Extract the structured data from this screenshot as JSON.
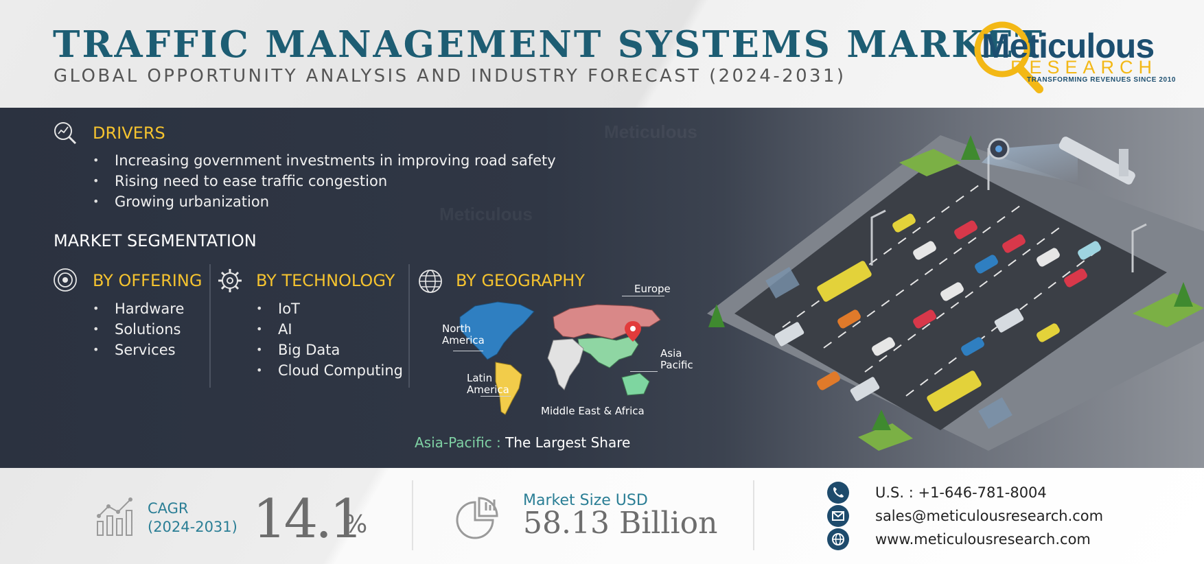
{
  "header": {
    "title": "TRAFFIC MANAGEMENT SYSTEMS MARKET",
    "subtitle": "GLOBAL OPPORTUNITY ANALYSIS AND INDUSTRY FORECAST (2024-2031)"
  },
  "logo": {
    "word_main": "Meticulous",
    "word_sub": "RESEARCH",
    "tagline": "TRANSFORMING REVENUES SINCE 2010"
  },
  "drivers": {
    "heading": "DRIVERS",
    "icon": "magnifier-chart-icon",
    "items": [
      "Increasing government investments in improving road safety",
      "Rising need to ease traffic congestion",
      "Growing urbanization"
    ]
  },
  "segmentation": {
    "title": "MARKET SEGMENTATION",
    "offering": {
      "heading": "BY OFFERING",
      "icon": "target-icon",
      "items": [
        "Hardware",
        "Solutions",
        "Services"
      ]
    },
    "technology": {
      "heading": "BY TECHNOLOGY",
      "icon": "gear-circuit-icon",
      "items": [
        "IoT",
        "AI",
        "Big Data",
        "Cloud Computing"
      ]
    },
    "geography": {
      "heading": "BY GEOGRAPHY",
      "icon": "globe-icon",
      "regions": {
        "europe": "Europe",
        "north_america": "North\nAmerica",
        "asia_pacific": "Asia\nPacific",
        "latin_america": "Latin\nAmerica",
        "mea": "Middle East & Africa"
      },
      "colors": {
        "north_america": "#2f7fc1",
        "europe_asia": "#d98888",
        "asia_pacific": "#8fd6a3",
        "latin_america": "#f2cc4a",
        "africa": "#e2e2e2",
        "oceania": "#7ed6a0"
      }
    },
    "largest_share": {
      "region": "Asia-Pacific :",
      "text": " The Largest Share"
    }
  },
  "footer": {
    "cagr": {
      "label": "CAGR",
      "period": "(2024-2031)",
      "value": "14.1",
      "unit": "%",
      "icon": "bar-chart-growth-icon"
    },
    "market_size": {
      "label": "Market Size USD",
      "value": "58.13 Billion",
      "icon": "pie-chart-icon"
    },
    "contacts": {
      "phone": "U.S. : +1-646-781-8004",
      "email": "sales@meticulousresearch.com",
      "website": "www.meticulousresearch.com",
      "icons": [
        "phone-icon",
        "mail-icon",
        "globe-icon"
      ]
    }
  },
  "colors": {
    "title": "#1d5d73",
    "accent_yellow": "#f5c32f",
    "teal_label": "#2a7e95",
    "dark_panel": "#2b3240",
    "contact_icon_bg": "#1e4b6c"
  }
}
